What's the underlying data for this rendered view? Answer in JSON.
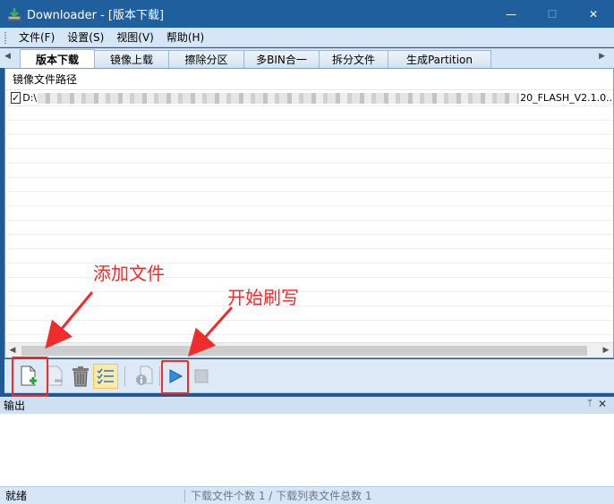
{
  "window": {
    "title": "Downloader - [版本下载]",
    "minimize_glyph": "—",
    "maximize_glyph": "☐",
    "close_glyph": "✕"
  },
  "menu": [
    "文件(F)",
    "设置(S)",
    "视图(V)",
    "帮助(H)"
  ],
  "tabs": [
    "版本下载",
    "镜像上载",
    "擦除分区",
    "多BIN合一",
    "拆分文件",
    "生成Partition"
  ],
  "active_tab": "版本下载",
  "file_list": {
    "column_header": "镜像文件路径",
    "rows": [
      {
        "checked": true,
        "path_start": "D:\\",
        "path_end": "20_FLASH_V2.1.0..."
      }
    ]
  },
  "toolbar": {
    "icons": [
      "add-file-icon",
      "remove-file-icon",
      "delete-icon",
      "checklist-icon",
      "file-info-icon",
      "start-icon",
      "stop-icon"
    ]
  },
  "output": {
    "title": "输出",
    "pin_glyph": "ᛘ",
    "close_glyph": "✕"
  },
  "status": {
    "left": "就绪",
    "right": "下载文件个数 1 / 下载列表文件总数 1"
  },
  "annotations": {
    "add_file": "添加文件",
    "start_flash": "开始刷写",
    "color": "#f22c2c"
  }
}
